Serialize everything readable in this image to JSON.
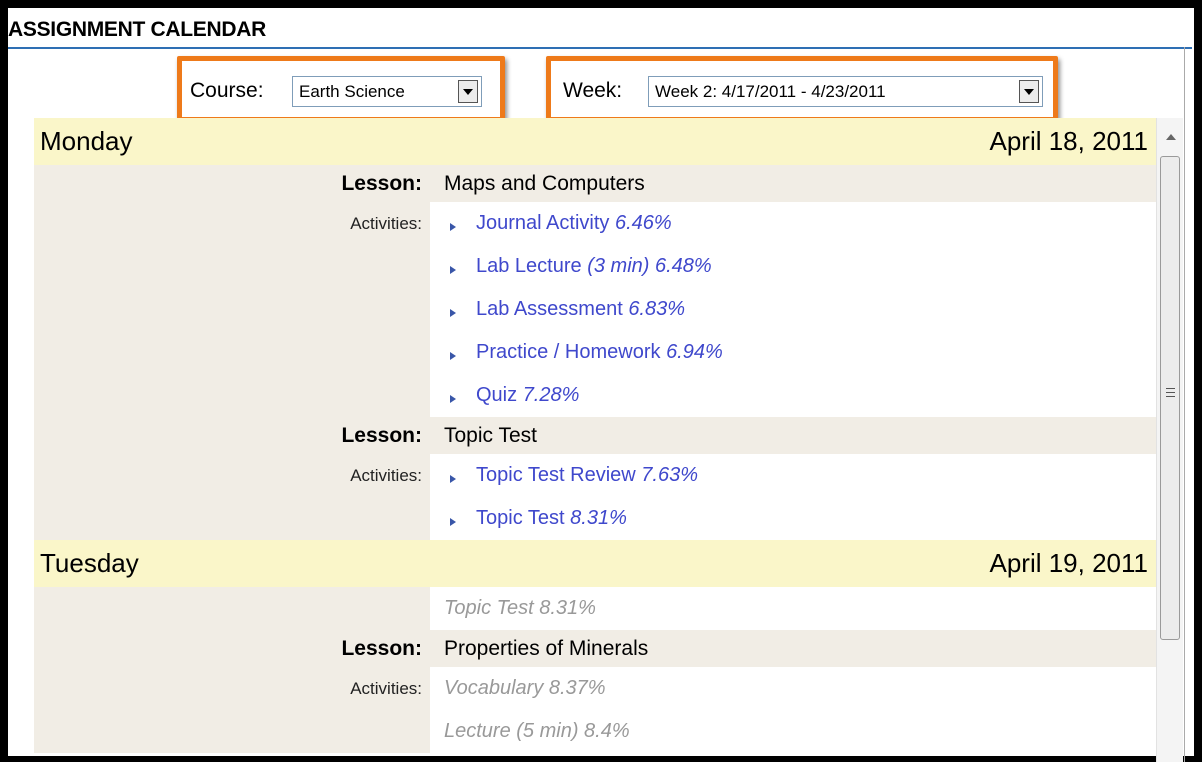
{
  "header": {
    "title": "ASSIGNMENT CALENDAR"
  },
  "filters": {
    "course_label": "Course:",
    "course_value": "Earth Science",
    "week_label": "Week:",
    "week_value": "Week 2: 4/17/2011 - 4/23/2011"
  },
  "colors": {
    "highlight": "#ee7a1a",
    "day_bg": "#faf6c9",
    "lesson_bg": "#f1ede5",
    "link": "#3f48cc",
    "rule": "#2e6fb4"
  },
  "days": [
    {
      "name": "Monday",
      "date": "April 18, 2011",
      "lessons": [
        {
          "label": "Lesson:",
          "title": "Maps and Computers",
          "activities_label": "Activities:",
          "activities": [
            {
              "name": "Journal Activity",
              "pct": "6.46%"
            },
            {
              "name": "Lab Lecture",
              "extra": "(3 min)",
              "pct": "6.48%"
            },
            {
              "name": "Lab Assessment",
              "pct": "6.83%"
            },
            {
              "name": "Practice / Homework",
              "pct": "6.94%"
            },
            {
              "name": "Quiz",
              "pct": "7.28%"
            }
          ]
        },
        {
          "label": "Lesson:",
          "title": "Topic Test",
          "activities_label": "Activities:",
          "activities": [
            {
              "name": "Topic Test Review",
              "pct": "7.63%"
            },
            {
              "name": "Topic Test",
              "pct": "8.31%"
            }
          ]
        }
      ]
    },
    {
      "name": "Tuesday",
      "date": "April 19, 2011",
      "carryover": "Topic Test 8.31%",
      "lessons": [
        {
          "label": "Lesson:",
          "title": "Properties of Minerals",
          "activities_label": "Activities:",
          "activities": [
            {
              "text": "Vocabulary 8.37%"
            },
            {
              "text": "Lecture (5 min) 8.4%"
            }
          ]
        }
      ]
    }
  ]
}
